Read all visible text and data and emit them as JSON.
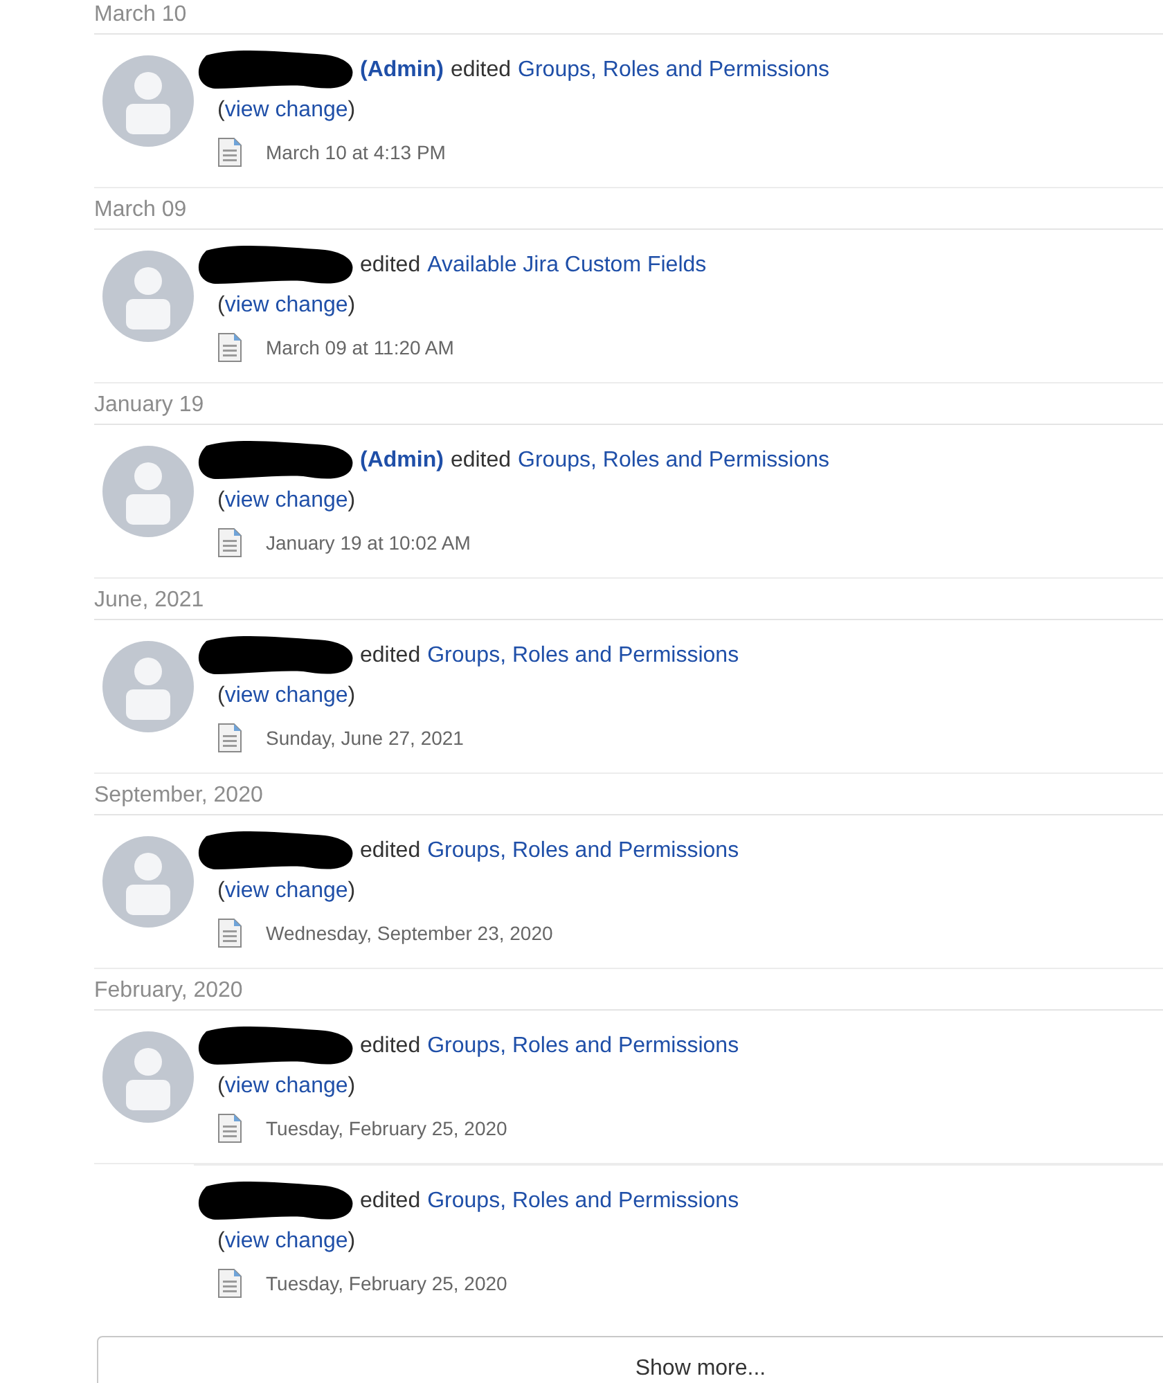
{
  "groups": [
    {
      "heading": "March 10",
      "entries": [
        {
          "avatar": true,
          "role": "(Admin)",
          "action": "edited",
          "page": "Groups, Roles and Permissions",
          "paren_open": "(",
          "view_change": "view change",
          "paren_close": ")",
          "date": "March 10 at 4:13 PM"
        }
      ]
    },
    {
      "heading": "March 09",
      "entries": [
        {
          "avatar": true,
          "action": "edited",
          "page": "Available Jira Custom Fields",
          "paren_open": "(",
          "view_change": "view change",
          "paren_close": ")",
          "date": "March 09 at 11:20 AM"
        }
      ]
    },
    {
      "heading": "January 19",
      "entries": [
        {
          "avatar": true,
          "role": "(Admin)",
          "action": "edited",
          "page": "Groups, Roles and Permissions",
          "paren_open": "(",
          "view_change": "view change",
          "paren_close": ")",
          "date": "January 19 at 10:02 AM"
        }
      ]
    },
    {
      "heading": "June, 2021",
      "entries": [
        {
          "avatar": true,
          "action": "edited",
          "page": "Groups, Roles and Permissions",
          "paren_open": "(",
          "view_change": "view change",
          "paren_close": ")",
          "date": "Sunday, June 27, 2021"
        }
      ]
    },
    {
      "heading": "September, 2020",
      "entries": [
        {
          "avatar": true,
          "action": "edited",
          "page": "Groups, Roles and Permissions",
          "paren_open": "(",
          "view_change": "view change",
          "paren_close": ")",
          "date": "Wednesday, September 23, 2020"
        }
      ]
    },
    {
      "heading": "February, 2020",
      "entries": [
        {
          "avatar": true,
          "action": "edited",
          "page": "Groups, Roles and Permissions",
          "paren_open": "(",
          "view_change": "view change",
          "paren_close": ")",
          "date": "Tuesday, February 25, 2020"
        },
        {
          "avatar": false,
          "action": "edited",
          "page": "Groups, Roles and Permissions",
          "paren_open": "(",
          "view_change": "view change",
          "paren_close": ")",
          "date": "Tuesday, February 25, 2020"
        }
      ]
    }
  ],
  "show_more": "Show more..."
}
